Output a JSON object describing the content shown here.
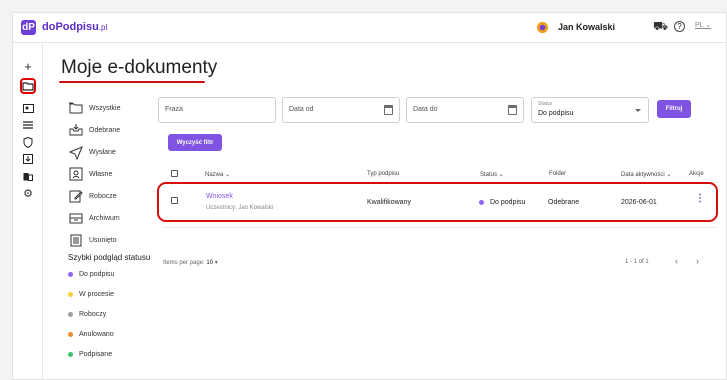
{
  "header": {
    "logo_main": "doPodpisu",
    "logo_suffix": ".pl",
    "user_name": "Jan Kowalski",
    "language": "PL"
  },
  "rail": {
    "items": [
      "plus-icon",
      "folder-icon",
      "contact-card-icon",
      "menu-icon",
      "shield-icon",
      "download-icon",
      "building-icon",
      "settings-icon"
    ]
  },
  "page": {
    "title": "Moje e-dokumenty"
  },
  "folders": [
    {
      "label": "Wszystkie",
      "icon": "folders-icon"
    },
    {
      "label": "Odebrane",
      "icon": "inbox-icon"
    },
    {
      "label": "Wysłane",
      "icon": "send-icon"
    },
    {
      "label": "Własne",
      "icon": "own-docs-icon"
    },
    {
      "label": "Robocze",
      "icon": "draft-edit-icon"
    },
    {
      "label": "Archiwum",
      "icon": "archive-icon"
    },
    {
      "label": "Usunięto",
      "icon": "trash-icon"
    }
  ],
  "quick_status": {
    "title": "Szybki podgląd statusu",
    "items": [
      {
        "label": "Do podpisu",
        "color": "#8e63f0"
      },
      {
        "label": "W procesie",
        "color": "#f2d03a"
      },
      {
        "label": "Roboczy",
        "color": "#9e9e9e"
      },
      {
        "label": "Anulowano",
        "color": "#f08a2c"
      },
      {
        "label": "Podpisane",
        "color": "#3cc26b"
      }
    ]
  },
  "filters": {
    "phrase_placeholder": "Fraza",
    "date_from_placeholder": "Data od",
    "date_to_placeholder": "Data do",
    "status_label": "Status",
    "status_value": "Do podpisu",
    "filter_button": "Filtruj",
    "clear_button": "Wyczyść filtr"
  },
  "table": {
    "headers": {
      "name": "Nazwa ⌄",
      "sign_type": "Typ podpisu",
      "status": "Status ⌄",
      "folder": "Folder",
      "active_date": "Data aktywności ⌄",
      "actions": "Akcje"
    },
    "rows": [
      {
        "name": "Wniosek",
        "participants": "Uczestnicy: Jan Kowalski",
        "sign_type": "Kwalifikowany",
        "status": "Do podpisu",
        "status_color": "#8e63f0",
        "folder": "Odebrane",
        "active_date": "2026-06-01"
      }
    ]
  },
  "pagination": {
    "items_per_page_label": "Items per page:",
    "items_per_page_value": "10",
    "range": "1 - 1 of 1"
  },
  "colors": {
    "accent": "#7f54e3",
    "highlight": "#d40f0f"
  }
}
